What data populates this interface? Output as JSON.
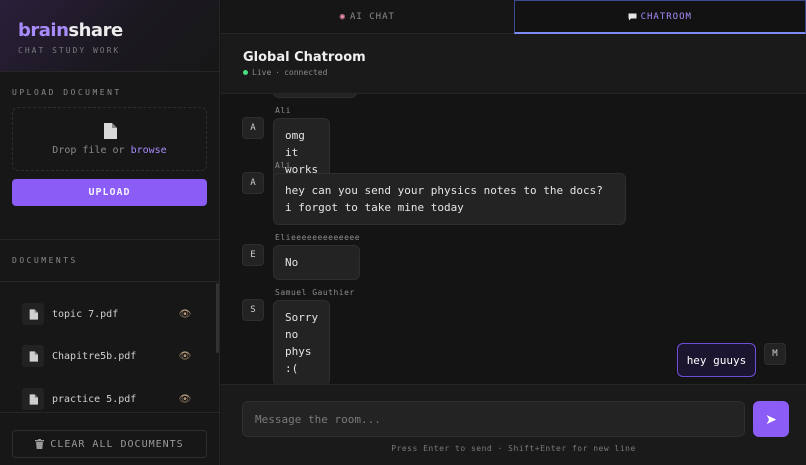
{
  "brand": {
    "logo_main": "brain",
    "logo_accent": "share",
    "tagline": "CHAT STUDY WORK"
  },
  "upload": {
    "section_label": "UPLOAD DOCUMENT",
    "drop_text": "Drop file or",
    "browse_link": "browse",
    "button_label": "UPLOAD"
  },
  "documents": {
    "section_label": "DOCUMENTS",
    "items": [
      {
        "name": "topic 7.pdf"
      },
      {
        "name": "Chapitre5b.pdf"
      },
      {
        "name": "practice 5.pdf"
      }
    ],
    "clear_label": "CLEAR ALL DOCUMENTS"
  },
  "tabs": [
    {
      "label": "AI CHAT",
      "icon": "brain-icon",
      "active": false
    },
    {
      "label": "CHATROOM",
      "icon": "speech-bubble-icon",
      "active": true
    }
  ],
  "room": {
    "title": "Global Chatroom",
    "status_live": "Live",
    "status_sep": "·",
    "status_text": "connected"
  },
  "messages": [
    {
      "avatar": "A",
      "sender": "Ali",
      "text": "omg it works"
    },
    {
      "avatar": "A",
      "sender": "Ali",
      "text": "hey can you send your physics notes to the docs? i forgot to take mine today"
    },
    {
      "avatar": "E",
      "sender": "Elieeeeeeeeeeeee",
      "text": "No"
    },
    {
      "avatar": "S",
      "sender": "Samuel Gauthier",
      "text": "Sorry no phys :("
    }
  ],
  "own_message": {
    "avatar": "M",
    "text": "hey guuys"
  },
  "composer": {
    "placeholder": "Message the room...",
    "send_icon": "➤",
    "hint": "Press Enter to send · Shift+Enter for new line"
  },
  "colors": {
    "accent": "#8b5cf6",
    "accent_light": "#a78bfa",
    "online": "#4ade80",
    "background": "#141414"
  }
}
